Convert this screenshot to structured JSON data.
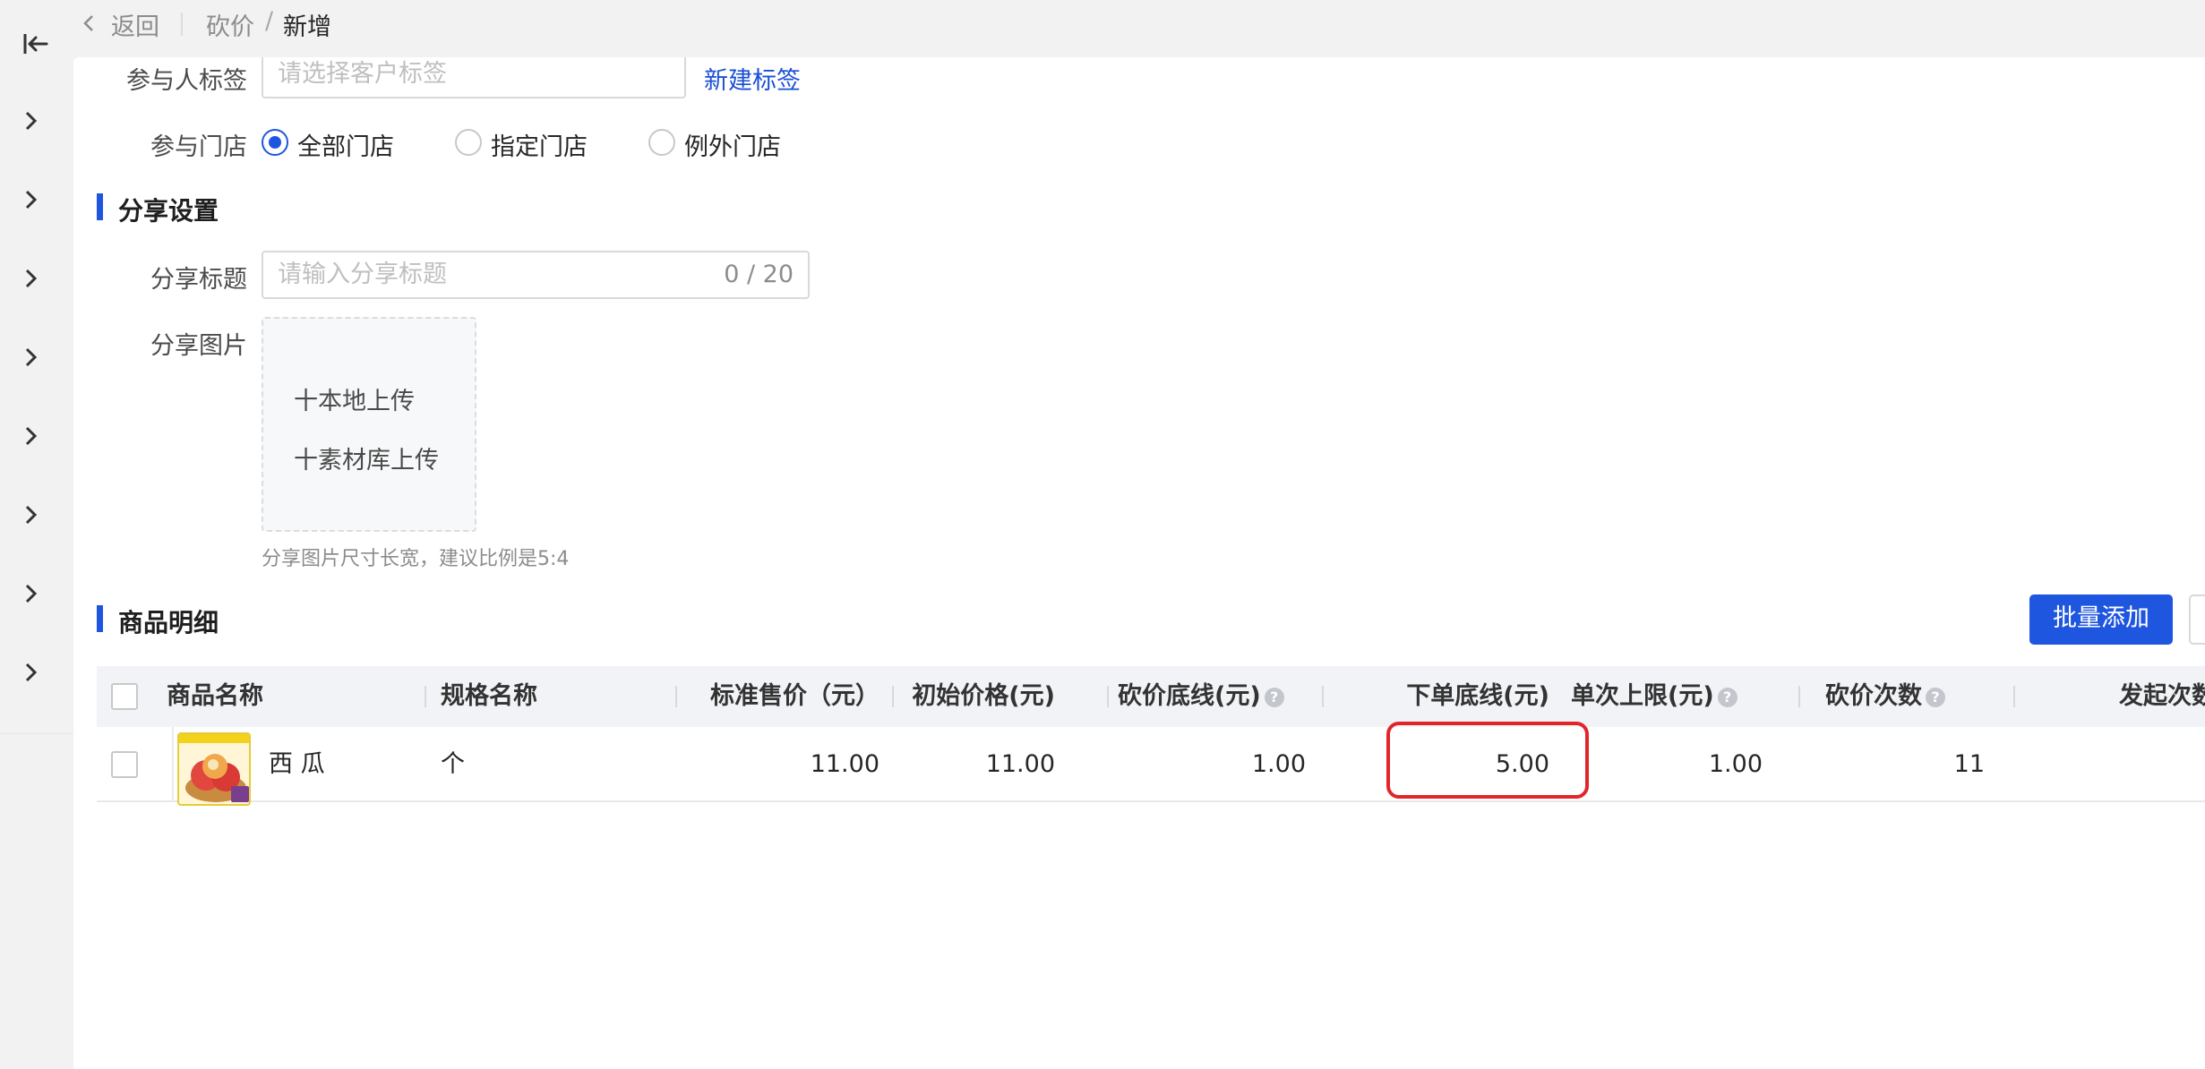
{
  "nav": {
    "back_label": "返回",
    "breadcrumb": [
      "砍价",
      "新增"
    ],
    "separator": "/"
  },
  "form": {
    "participant_tag": {
      "label": "参与人标签",
      "placeholder": "请选择客户标签",
      "new_tag_link": "新建标签"
    },
    "participant_store": {
      "label": "参与门店",
      "options": [
        "全部门店",
        "指定门店",
        "例外门店"
      ],
      "selected": "全部门店"
    }
  },
  "share": {
    "section_title": "分享设置",
    "title_label": "分享标题",
    "title_placeholder": "请输入分享标题",
    "title_counter": "0 / 20",
    "image_label": "分享图片",
    "upload_local": "十本地上传",
    "upload_library": "十素材库上传",
    "image_hint": "分享图片尺寸长宽，建议比例是5:4"
  },
  "products": {
    "section_title": "商品明细",
    "batch_add_button": "批量添加",
    "columns": [
      "商品名称",
      "规格名称",
      "标准售价（元）",
      "初始价格(元)",
      "砍价底线(元)",
      "下单底线(元)",
      "单次上限(元)",
      "砍价次数",
      "发起次数"
    ],
    "help_icon_glyph": "?",
    "rows": [
      {
        "name": "西 瓜",
        "spec": "个",
        "standard_price": "11.00",
        "initial_price": "11.00",
        "bargain_floor": "1.00",
        "order_floor": "5.00",
        "single_limit": "1.00",
        "bargain_count": "11",
        "launch_count": ""
      }
    ]
  },
  "colors": {
    "primary": "#1f56e0",
    "link": "#1a4fd6",
    "highlight": "#e1262b"
  }
}
